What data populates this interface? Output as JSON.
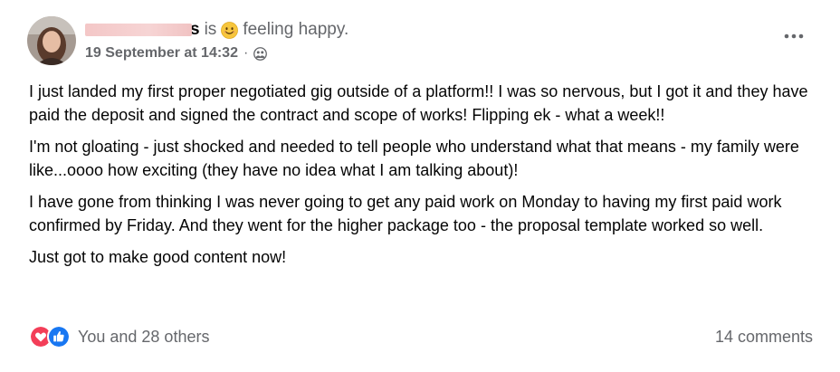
{
  "post": {
    "author_suffix": "s",
    "status_prefix": "is",
    "feeling": "feeling happy.",
    "feeling_icon": "smiling-face-emoji",
    "timestamp": "19 September at 14:32",
    "separator": "·",
    "audience_icon": "friends-icon",
    "more_icon": "more-options-icon",
    "paragraphs": [
      "I just landed my first proper negotiated gig outside of a platform!! I was so nervous, but I got it and they have paid the deposit and signed the contract and scope of works! Flipping ek - what a week!!",
      "I'm not gloating - just shocked and needed to tell people who understand what that means - my family were like...oooo how exciting (they have no idea what I am talking about)!",
      "I have gone from thinking I was never going to get any paid work on Monday to having my first paid work confirmed by Friday. And they went for the higher package too - the proposal template worked so well.",
      "Just got to make good content now!"
    ]
  },
  "footer": {
    "reactions_text": "You and 28 others",
    "reaction_icons": [
      "love-reaction-icon",
      "like-reaction-icon"
    ],
    "comments_text": "14 comments"
  },
  "colors": {
    "secondary_text": "#65676b",
    "primary_text": "#050505",
    "love_red": "#f33e58",
    "like_blue": "#1877f2"
  }
}
